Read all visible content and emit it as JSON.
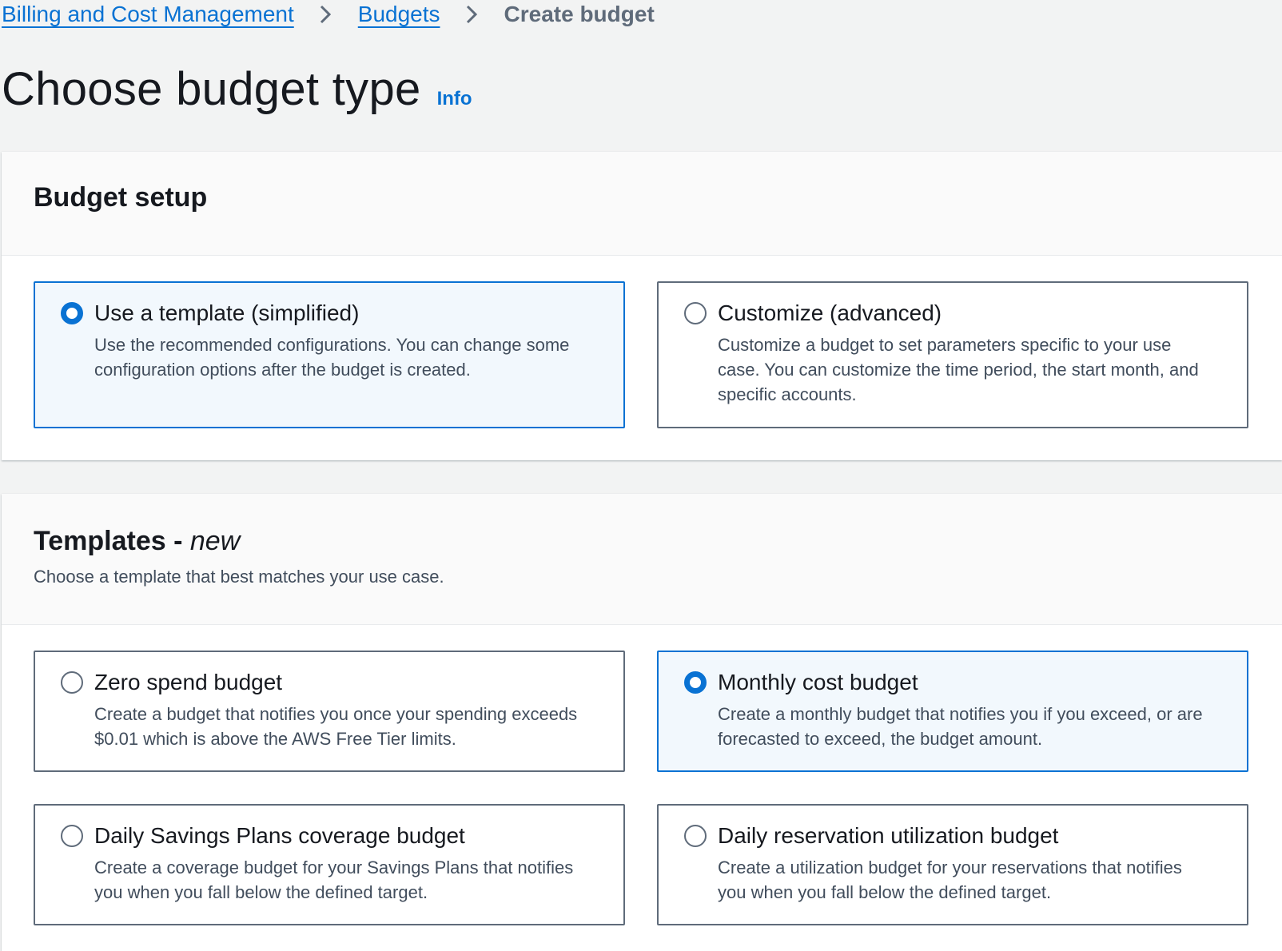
{
  "breadcrumb": {
    "items": [
      "Billing and Cost Management",
      "Budgets"
    ],
    "current": "Create budget"
  },
  "page": {
    "title": "Choose budget type",
    "info": "Info"
  },
  "budget_setup": {
    "title": "Budget setup",
    "options": [
      {
        "label": "Use a template (simplified)",
        "description": "Use the recommended configurations. You can change some configuration options after the budget is created.",
        "selected": true
      },
      {
        "label": "Customize (advanced)",
        "description": "Customize a budget to set parameters specific to your use case. You can customize the time period, the start month, and specific accounts.",
        "selected": false
      }
    ]
  },
  "templates": {
    "title": "Templates - ",
    "title_suffix": "new",
    "description": "Choose a template that best matches your use case.",
    "options": [
      {
        "label": "Zero spend budget",
        "description": "Create a budget that notifies you once your spending exceeds $0.01 which is above the AWS Free Tier limits.",
        "selected": false
      },
      {
        "label": "Monthly cost budget",
        "description": "Create a monthly budget that notifies you if you exceed, or are forecasted to exceed, the budget amount.",
        "selected": true
      },
      {
        "label": "Daily Savings Plans coverage budget",
        "description": "Create a coverage budget for your Savings Plans that notifies you when you fall below the defined target.",
        "selected": false
      },
      {
        "label": "Daily reservation utilization budget",
        "description": "Create a utilization budget for your reservations that notifies you when you fall below the defined target.",
        "selected": false
      }
    ]
  },
  "colors": {
    "accent": "#0972d3",
    "selected_bg": "#f2f8fd",
    "border": "#5f6b7a"
  }
}
